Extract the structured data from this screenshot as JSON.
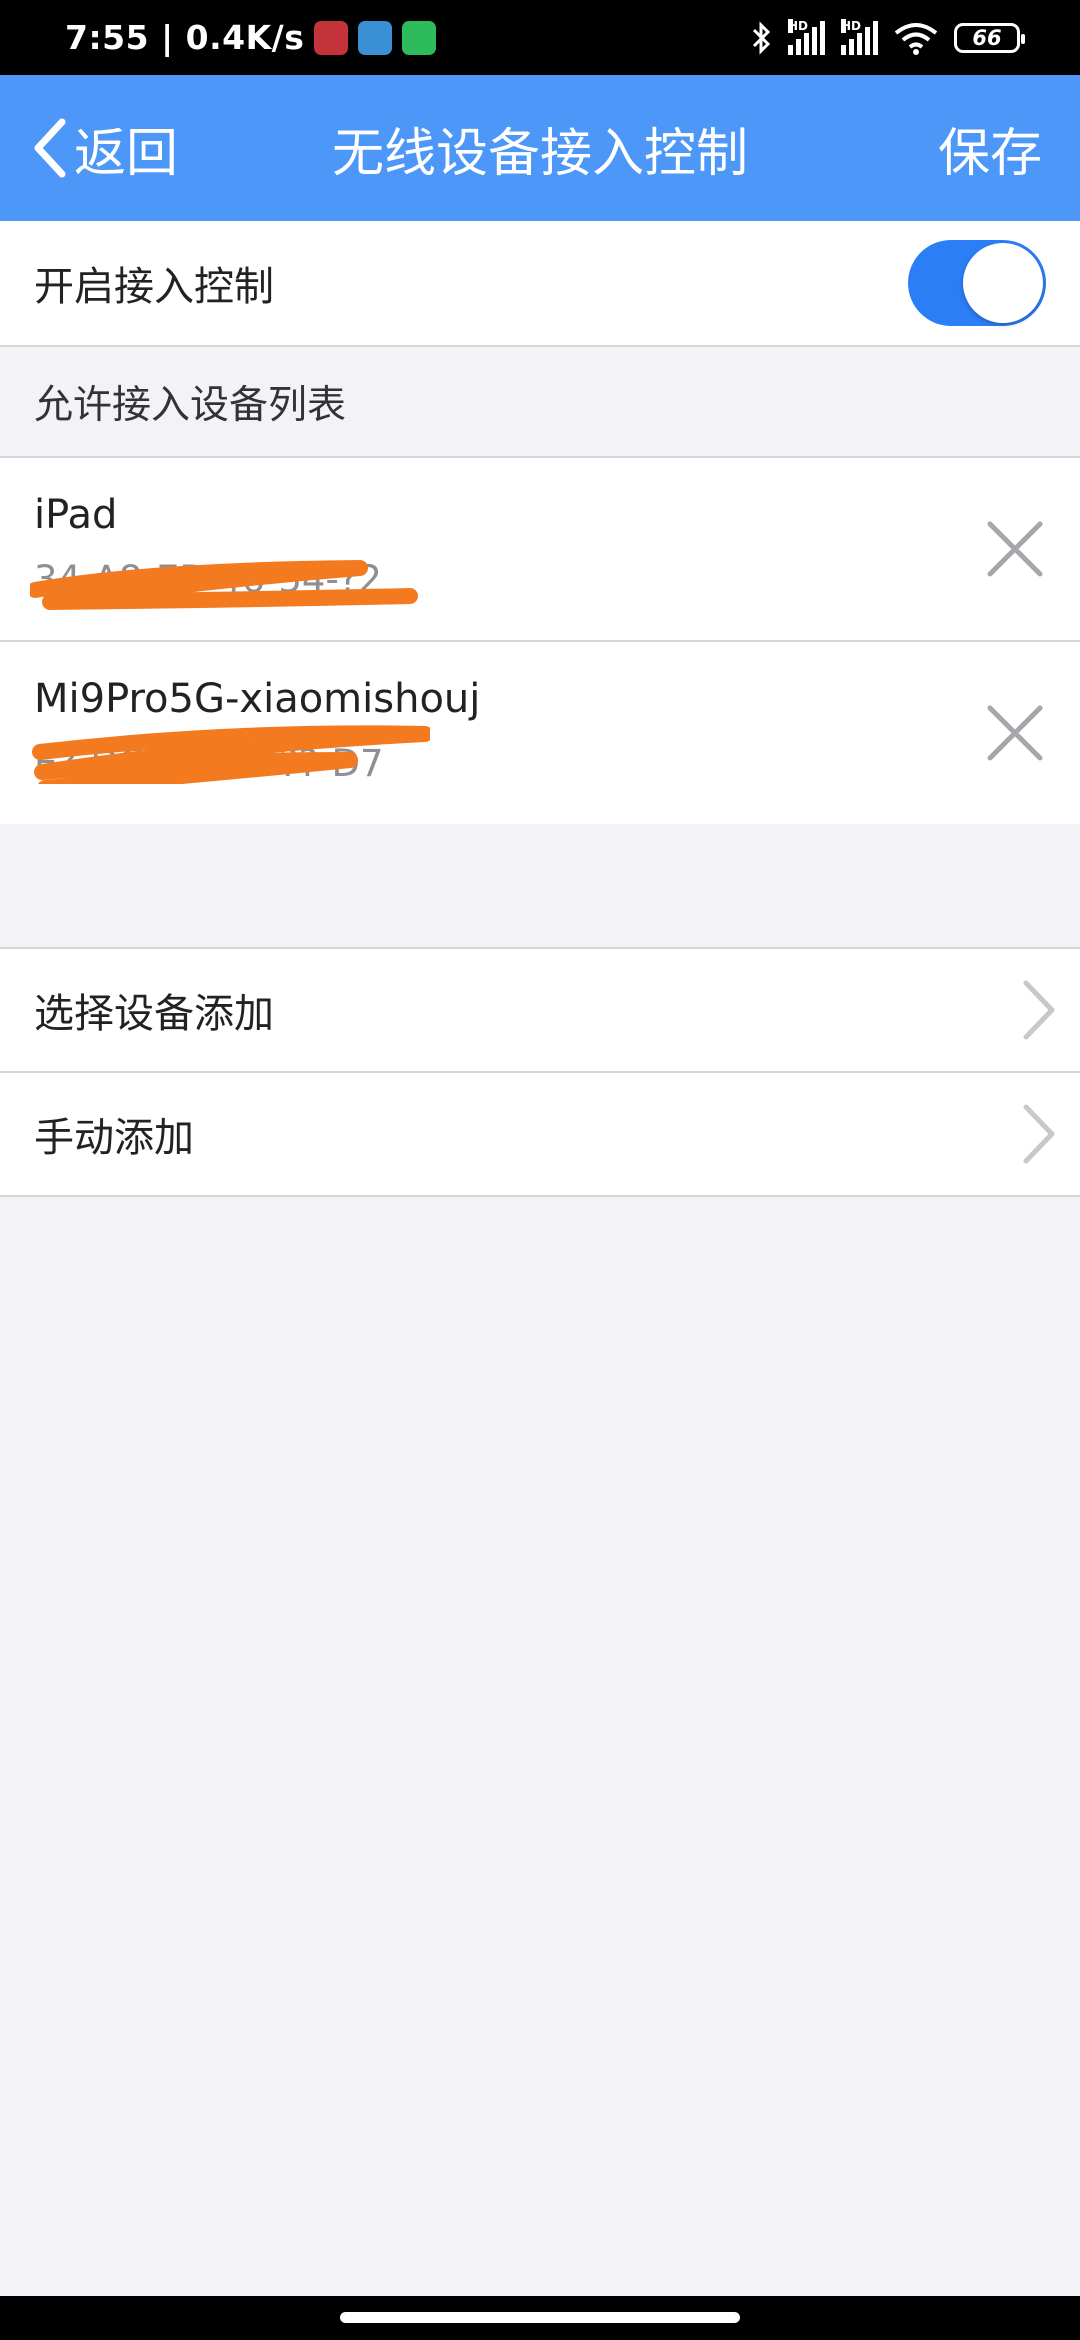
{
  "status_bar": {
    "time_speed": "7:55 | 0.4K/s",
    "signal_label_1": "HD",
    "signal_label_2": "HD",
    "battery": "66"
  },
  "nav": {
    "back_label": "返回",
    "title": "无线设备接入控制",
    "save_label": "保存"
  },
  "access_control": {
    "label": "开启接入控制",
    "enabled": true
  },
  "allowed_list": {
    "header": "允许接入设备列表",
    "devices": [
      {
        "name": "iPad",
        "mac": "34-A8-EB-46-54-?2"
      },
      {
        "name": "Mi9Pro5G-xiaomishouj",
        "mac": "E?-DC-55-57-??-D7"
      }
    ]
  },
  "actions": {
    "select_add": "选择设备添加",
    "manual_add": "手动添加"
  },
  "colors": {
    "nav_blue": "#4c97f7",
    "toggle_on": "#2c7ef7",
    "redaction_orange": "#f47a20",
    "background": "#f2f2f7"
  }
}
